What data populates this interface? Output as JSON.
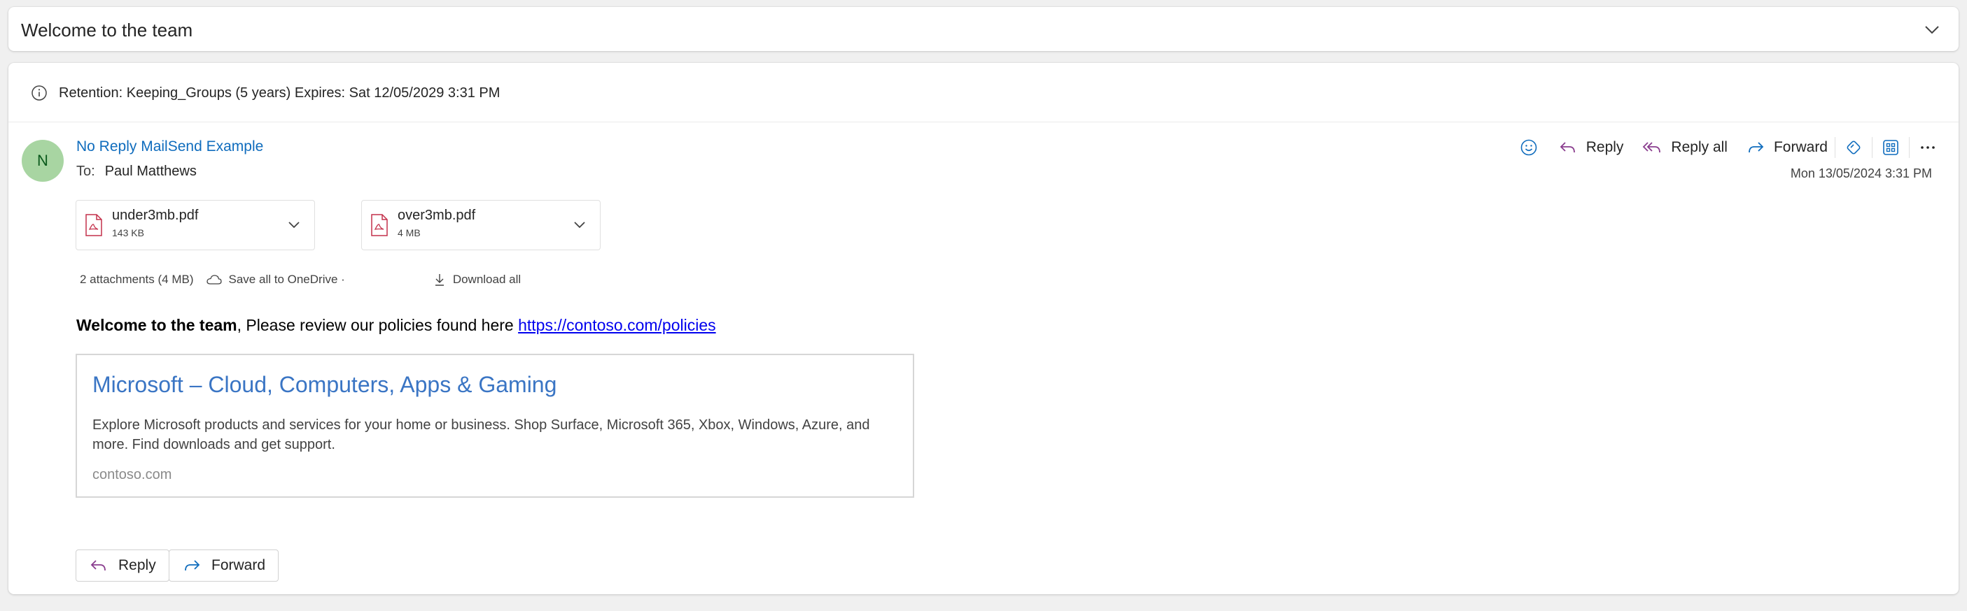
{
  "header": {
    "subject": "Welcome to the team"
  },
  "retention": {
    "text": "Retention: Keeping_Groups (5 years) Expires: Sat 12/05/2029 3:31 PM"
  },
  "message": {
    "avatar_initial": "N",
    "sender": "No Reply MailSend Example",
    "to_label": "To:",
    "to_name": "Paul Matthews",
    "date": "Mon 13/05/2024 3:31 PM"
  },
  "actions": {
    "reply": "Reply",
    "reply_all": "Reply all",
    "forward": "Forward"
  },
  "attachments": [
    {
      "name": "under3mb.pdf",
      "size": "143 KB"
    },
    {
      "name": "over3mb.pdf",
      "size": "4 MB"
    }
  ],
  "attachment_bar": {
    "summary": "2 attachments (4 MB)",
    "save_onedrive": "Save all to OneDrive ·",
    "download_all": "Download all"
  },
  "body": {
    "bold": "Welcome to the team",
    "text": ", Please review our policies found here ",
    "link": "https://contoso.com/policies"
  },
  "preview": {
    "title": "Microsoft – Cloud, Computers, Apps & Gaming",
    "description": "Explore Microsoft products and services for your home or business. Shop Surface, Microsoft 365, Xbox, Windows, Azure, and more. Find downloads and get support.",
    "domain": "contoso.com"
  },
  "bottom_actions": {
    "reply": "Reply",
    "forward": "Forward"
  },
  "colors": {
    "accent": "#0f6cbd",
    "reply_icon": "#8a3d8e",
    "forward_icon": "#0f6cbd",
    "avatar_bg": "#a8d5a2",
    "pdf_red": "#c4314b"
  }
}
